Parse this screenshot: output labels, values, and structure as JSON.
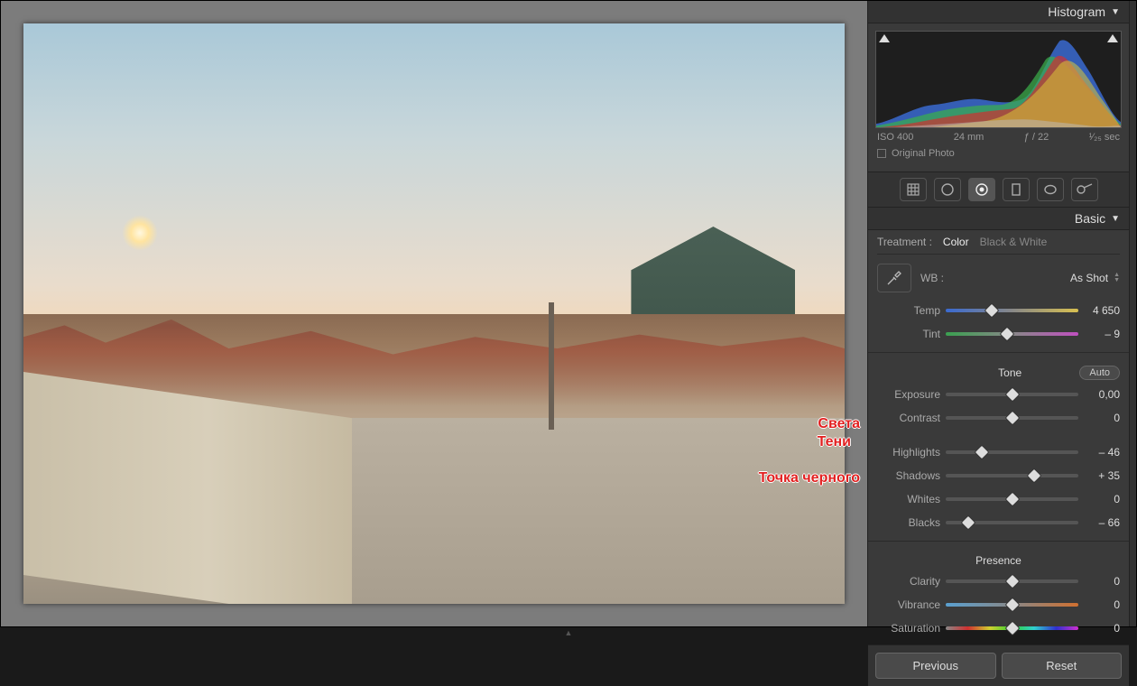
{
  "panel": {
    "histogram": {
      "title": "Histogram",
      "iso": "ISO 400",
      "focal": "24 mm",
      "aperture": "ƒ / 22",
      "shutter": "¹⁄₂₅ sec",
      "original_label": "Original Photo"
    },
    "basic": {
      "title": "Basic",
      "treatment_label": "Treatment :",
      "treatment_color": "Color",
      "treatment_bw": "Black & White",
      "wb_label": "WB :",
      "wb_value": "As Shot",
      "tone_label": "Tone",
      "auto_label": "Auto",
      "presence_label": "Presence",
      "sliders": {
        "temp": {
          "label": "Temp",
          "value": "4 650",
          "pos": 35
        },
        "tint": {
          "label": "Tint",
          "value": "– 9",
          "pos": 46
        },
        "exposure": {
          "label": "Exposure",
          "value": "0,00",
          "pos": 50
        },
        "contrast": {
          "label": "Contrast",
          "value": "0",
          "pos": 50
        },
        "highlights": {
          "label": "Highlights",
          "value": "– 46",
          "pos": 27
        },
        "shadows": {
          "label": "Shadows",
          "value": "+ 35",
          "pos": 67
        },
        "whites": {
          "label": "Whites",
          "value": "0",
          "pos": 50
        },
        "blacks": {
          "label": "Blacks",
          "value": "– 66",
          "pos": 17
        },
        "clarity": {
          "label": "Clarity",
          "value": "0",
          "pos": 50
        },
        "vibrance": {
          "label": "Vibrance",
          "value": "0",
          "pos": 50
        },
        "saturation": {
          "label": "Saturation",
          "value": "0",
          "pos": 50
        }
      }
    },
    "footer": {
      "prev": "Previous",
      "reset": "Reset"
    }
  },
  "annotations": {
    "lights": "Света",
    "shadows": "Тени",
    "blackpoint": "Точка черного"
  }
}
